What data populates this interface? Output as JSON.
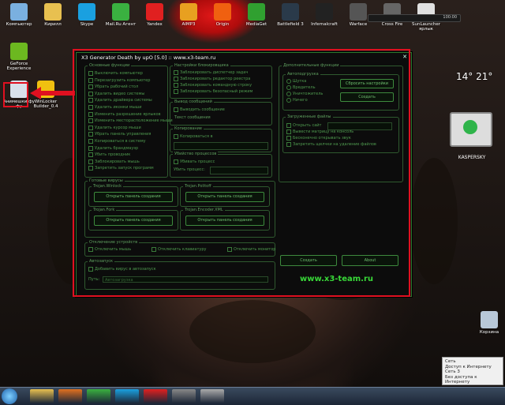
{
  "desktop_icons": [
    {
      "label": "Компьютер",
      "icon": "computer-icon",
      "color": "#7ab0e0"
    },
    {
      "label": "Кирилл",
      "icon": "folder-icon",
      "color": "#e8c050"
    },
    {
      "label": "Skype",
      "icon": "skype-icon",
      "color": "#1aa0e0"
    },
    {
      "label": "Mail.Ru Агент",
      "icon": "mailru-agent-icon",
      "color": "#3ab040"
    },
    {
      "label": "Yandex",
      "icon": "yandex-icon",
      "color": "#e02020"
    },
    {
      "label": "AIMP3",
      "icon": "aimp-icon",
      "color": "#e8a020"
    },
    {
      "label": "Origin",
      "icon": "origin-icon",
      "color": "#f06010"
    },
    {
      "label": "MediaGet",
      "icon": "mediaget-icon",
      "color": "#30a030"
    },
    {
      "label": "Battlefield 3",
      "icon": "battlefield-icon",
      "color": "#2a3a4a"
    },
    {
      "label": "Infernalcraft",
      "icon": "infernalcraft-icon",
      "color": "#222222"
    },
    {
      "label": "Warface",
      "icon": "warface-icon",
      "color": "#555555"
    },
    {
      "label": "Cross Fire",
      "icon": "crossfire-icon",
      "color": "#666666"
    },
    {
      "label": "SunLauncher ярлык",
      "icon": "java-icon",
      "color": "#e0e0e0"
    }
  ],
  "left_icons": [
    {
      "label": "GeForce Experience",
      "icon": "geforce-icon",
      "color": "#6cb820"
    },
    {
      "label": "Анимешки фу фу",
      "icon": "settings-file-icon",
      "color": "#d8e0ea"
    },
    {
      "label": "WinLocker Builder_0.4",
      "icon": "radiation-icon",
      "color": "#f0c010"
    }
  ],
  "window": {
    "title": "X3 Generator Death by upO [5.0] :: www.x3-team.ru",
    "close": "✕",
    "groups": {
      "basic": "Основные функции",
      "block": "Настройки блокировщика",
      "extra": "Дополнительные функции",
      "autoload": "Автоподгрузка",
      "msg_out": "Вывод сообщений",
      "msg_text": "Текст сообщения",
      "copy": "Копирование",
      "kill": "Убийство процессов",
      "files": "Загруженные файлы",
      "viruses": "Готовые вирусы",
      "disable": "Отключение устройств",
      "autorun": "Автозапуск"
    },
    "basic_items": [
      "Выключить компьютер",
      "Перезагрузить компьютер",
      "Убрать рабочий стол",
      "Удалить видео системы",
      "Удалить драйвера системы",
      "Удалить иконки мыши",
      "Изменить разрешение ярлыков",
      "Изменить месторасположение мыши",
      "Удалить курсор мыши",
      "Убрать панель управления",
      "Копироваться в систему",
      "Удалить брандмауэр",
      "Убить проводник",
      "Заблокировать мышь",
      "Запретить запуск программ"
    ],
    "block_items": [
      "Заблокировать диспетчер задач",
      "Заблокировать редактор реестра",
      "Заблокировать командную строку",
      "Заблокировать безопасный режим"
    ],
    "msg_item": "Выводить сообщение",
    "copy_item": "Копироваться в",
    "kill_items": [
      "Убивать процесс",
      "Убить процесс:"
    ],
    "autoload_options": [
      "Шутка",
      "Вредитель",
      "Уничтожитель",
      "Ничего"
    ],
    "autoload_buttons": [
      "Сбросить настройки",
      "Создать"
    ],
    "files_items": [
      "Открыть сайт",
      "Вывести матрицу на консоль",
      "Бесконечно открывать звук",
      "Запретить щелчки на удаление файлов"
    ],
    "virus_groups": [
      {
        "title": "Trojan.Winlock",
        "button": "Открыть панель создания"
      },
      {
        "title": "Trojan.Politoff",
        "button": "Открыть панель создания"
      },
      {
        "title": "Trojan.Fork",
        "button": "Открыть панель создания"
      },
      {
        "title": "Trojan.Encoder.XML",
        "button": "Открыть панель создания"
      }
    ],
    "disable_items": [
      "Отключить мышь",
      "Отключить клавиатуру",
      "Отключить монитор"
    ],
    "autorun_item": "Добавить вирус в автозапуск",
    "path_label": "Путь:",
    "path_value": "Автозагрузка",
    "create_button": "Создать",
    "about_button": "About",
    "site": "www.x3-team.ru"
  },
  "clock": {
    "text": "14° 21°",
    "label": ""
  },
  "gadget_text": "100:00",
  "kaspersky_label": "KASPERSKY",
  "recycle_label": "Корзина",
  "network_popup": [
    "Сеть",
    "Доступ к Интернету",
    "Сеть 3",
    "Без доступа к Интернету"
  ],
  "taskbar_apps": [
    {
      "name": "explorer-icon",
      "color": "#e8c050"
    },
    {
      "name": "media-player-icon",
      "color": "#e07020"
    },
    {
      "name": "agent-icon",
      "color": "#3ab040"
    },
    {
      "name": "skype-icon",
      "color": "#1aa0e0"
    },
    {
      "name": "yandex-icon",
      "color": "#e02020"
    },
    {
      "name": "app-icon",
      "color": "#888888"
    },
    {
      "name": "app-icon",
      "color": "#aaaaaa"
    }
  ]
}
